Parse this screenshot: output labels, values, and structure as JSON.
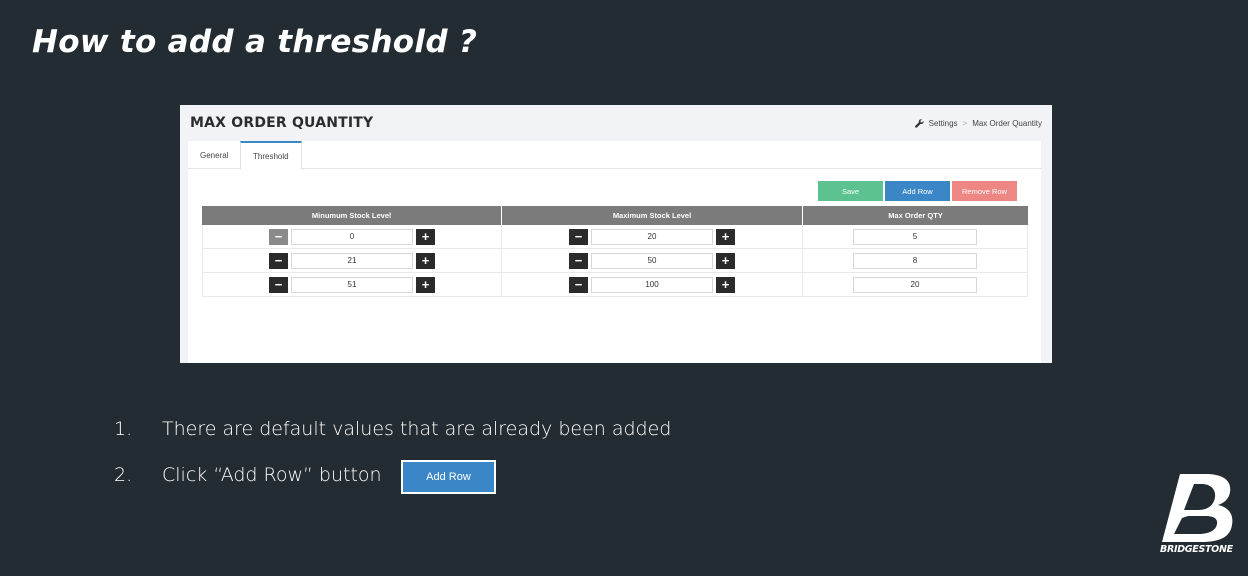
{
  "slide": {
    "title": "How to add a threshold ?",
    "steps": [
      {
        "num": "1.",
        "text": "There are default values that are already been added"
      },
      {
        "num": "2.",
        "text": "Click “Add Row” button"
      }
    ],
    "step_button_label": "Add Row",
    "logo_text": "BRIDGESTONE"
  },
  "app": {
    "page_title": "MAX ORDER QUANTITY",
    "breadcrumb": [
      "Settings",
      "Max Order Quantity"
    ],
    "tabs": [
      "General",
      "Threshold"
    ],
    "buttons": {
      "save": "Save",
      "add_row": "Add Row",
      "remove_row": "Remove Row"
    },
    "columns": [
      "Minumum Stock Level",
      "Maximum Stock Level",
      "Max Order QTY"
    ],
    "rows": [
      {
        "min": "0",
        "max": "20",
        "qty": "5"
      },
      {
        "min": "21",
        "max": "50",
        "qty": "8"
      },
      {
        "min": "51",
        "max": "100",
        "qty": "20"
      }
    ],
    "stepper": {
      "minus": "−",
      "plus": "+"
    }
  },
  "colors": {
    "background": "#232c32",
    "save": "#5cc390",
    "add_row": "#3b86c6",
    "remove_row": "#ee8784",
    "table_header": "#7b7b7b"
  }
}
